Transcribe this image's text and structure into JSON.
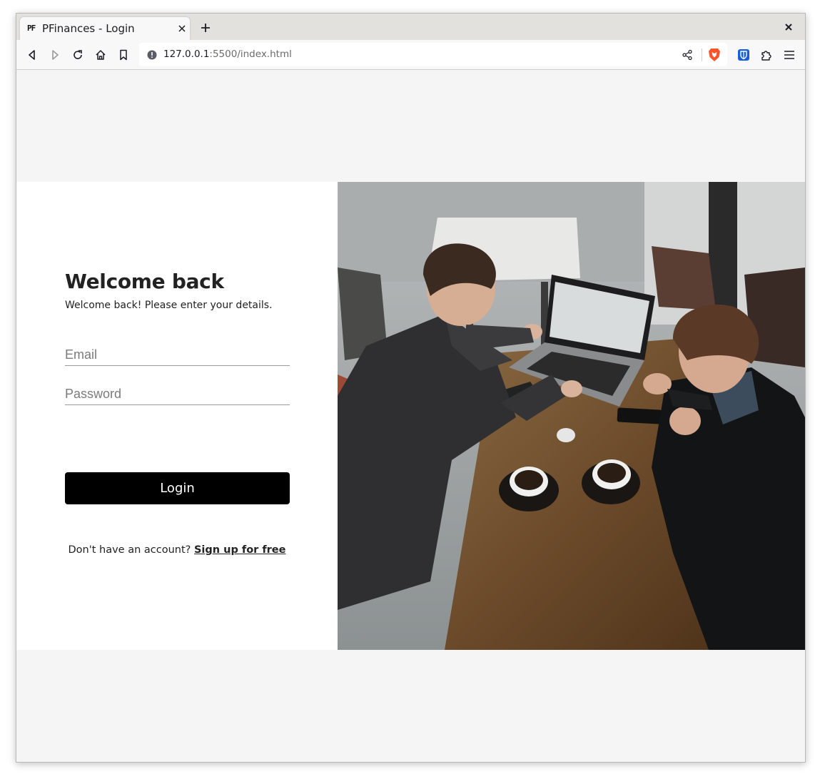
{
  "browser": {
    "tab_title": "PFinances - Login",
    "favicon_text": "PF",
    "url_host": "127.0.0.1",
    "url_rest": ":5500/index.html",
    "icons": {
      "back": "back-arrow-icon",
      "forward": "forward-arrow-icon",
      "reload": "reload-icon",
      "home": "home-icon",
      "bookmark": "bookmark-icon",
      "share": "share-icon",
      "brave": "brave-lion-icon",
      "bitwarden": "bitwarden-shield-icon",
      "extensions": "puzzle-piece-icon",
      "menu": "hamburger-menu-icon"
    }
  },
  "login": {
    "heading": "Welcome back",
    "subheading": "Welcome back! Please enter your details.",
    "email_placeholder": "Email",
    "password_placeholder": "Password",
    "login_button": "Login",
    "signup_prompt": "Don't have an account?",
    "signup_link": "Sign up for free"
  },
  "colors": {
    "page_bg": "#f5f5f5",
    "card_bg": "#ffffff",
    "button_bg": "#000000",
    "button_text": "#ffffff",
    "text": "#222222",
    "brave_orange": "#fb542b",
    "bitwarden_blue": "#175ddc"
  }
}
